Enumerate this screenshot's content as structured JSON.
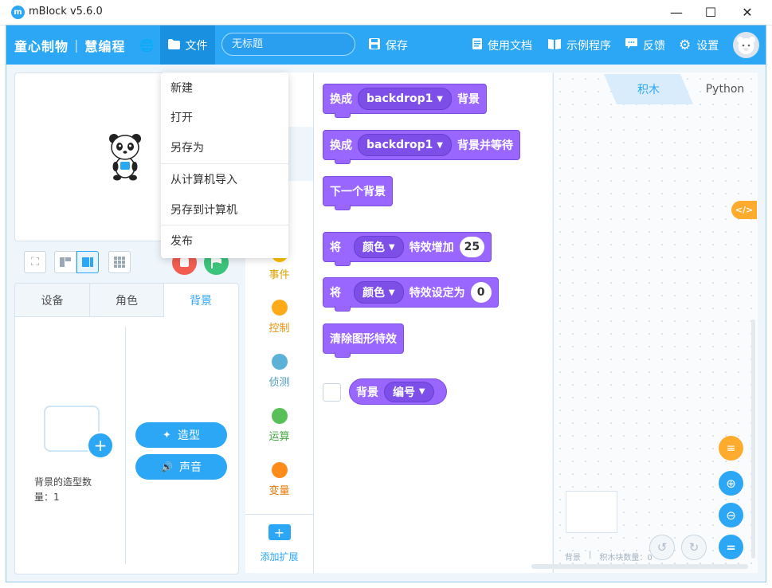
{
  "window": {
    "title": "mBlock v5.6.0",
    "controls": {
      "minimize": "—",
      "maximize": "☐",
      "close": "✕"
    }
  },
  "menubar": {
    "brand_left": "童心制物",
    "brand_right": "慧编程",
    "file_label": "文件",
    "project_title_placeholder": "无标题",
    "save_label": "保存",
    "docs_label": "使用文档",
    "examples_label": "示例程序",
    "feedback_label": "反馈",
    "settings_label": "设置"
  },
  "file_menu": {
    "items": [
      "新建",
      "打开",
      "另存为",
      "从计算机导入",
      "另存到计算机",
      "发布"
    ]
  },
  "sprite_panel": {
    "tabs": [
      {
        "label": "设备",
        "active": false
      },
      {
        "label": "角色",
        "active": false
      },
      {
        "label": "背景",
        "active": true
      }
    ],
    "backdrop_count_text": "背景的造型数量：1",
    "costume_button": "造型",
    "sound_button": "声音"
  },
  "categories": {
    "items": [
      {
        "label": "事件",
        "color": "#ffbf00"
      },
      {
        "label": "控制",
        "color": "#ffab19"
      },
      {
        "label": "侦测",
        "color": "#5cb1d6"
      },
      {
        "label": "运算",
        "color": "#59c059"
      },
      {
        "label": "变量",
        "color": "#ff8c1a"
      }
    ],
    "add_extension_label": "添加扩展"
  },
  "blocks": {
    "switch_backdrop": {
      "prefix": "换成",
      "dropdown": "backdrop1",
      "suffix": "背景"
    },
    "switch_backdrop_wait": {
      "prefix": "换成",
      "dropdown": "backdrop1",
      "suffix": "背景并等待"
    },
    "next_backdrop": {
      "label": "下一个背景"
    },
    "change_effect": {
      "prefix": "将",
      "dropdown": "颜色",
      "middle": "特效增加",
      "value": "25"
    },
    "set_effect": {
      "prefix": "将",
      "dropdown": "颜色",
      "middle": "特效设定为",
      "value": "0"
    },
    "clear_effects": {
      "label": "清除图形特效"
    },
    "backdrop_reporter": {
      "prefix": "背景",
      "dropdown": "编号"
    }
  },
  "script_area": {
    "tabs": [
      {
        "label": "积木",
        "active": true
      },
      {
        "label": "Python",
        "active": false
      }
    ],
    "code_toggle": "</>",
    "footer_sprite": "背景",
    "footer_block_count": "积木块数量：0"
  },
  "colors": {
    "accent": "#2ba7f5",
    "looks_block": "#9966ff",
    "stop": "#f25d52",
    "run": "#3cc47c",
    "orange": "#ffab2e"
  },
  "icons": {
    "globe": "globe-icon",
    "folder": "folder-icon",
    "save": "save-icon",
    "docs": "document-icon",
    "examples": "book-icon",
    "feedback": "chat-icon",
    "settings": "gear-icon"
  }
}
